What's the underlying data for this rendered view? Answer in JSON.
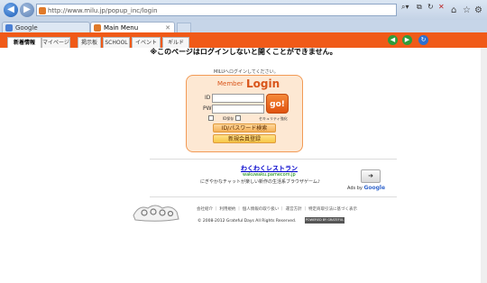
{
  "browser": {
    "address": "http://www.milu.jp/popup_inc/login",
    "tabs": [
      {
        "label": "Google"
      },
      {
        "label": "Main Menu"
      }
    ],
    "window_controls": [
      "–",
      "▭",
      "✕"
    ]
  },
  "site": {
    "nav_tabs": [
      "新着情報",
      "マイページ",
      "掲示板",
      "SCHOOL",
      "イベント",
      "ギルド"
    ],
    "warning": "※このページはログインしないと開くことができません。",
    "milu_note": "MILUへログインしてください。",
    "login": {
      "member_label": "Member",
      "login_label": "Login",
      "id_label": "ID",
      "pw_label": "PW",
      "id_value": "",
      "pw_value": "",
      "go_label": "go!",
      "save_id_label": "ID保存",
      "secure_label": "セキュリティ強化",
      "search_label": "ID/パスワード検索",
      "register_label": "新規会員登録"
    },
    "ad": {
      "title": "わくわくレストラン",
      "url": "wakuwaku.pamecom.jp",
      "description": "にぎやかなチャットが楽しい新作の生活系ブラウザゲーム♪",
      "ads_by": "Ads by",
      "google": "Google"
    },
    "footer": {
      "links": "会社紹介 ｜ 利用規約 ｜ 個人情報の取り扱い ｜ 運営方針 ｜ 特定商取引法に基づく表示",
      "copyright": "© 2008-2012 Grateful Days All Rights Reserved.",
      "badge": "POWERED BY GRATEFUL DAYS"
    }
  },
  "colors": {
    "accent": "#f05a18",
    "login_bg": "#fde8d3"
  }
}
